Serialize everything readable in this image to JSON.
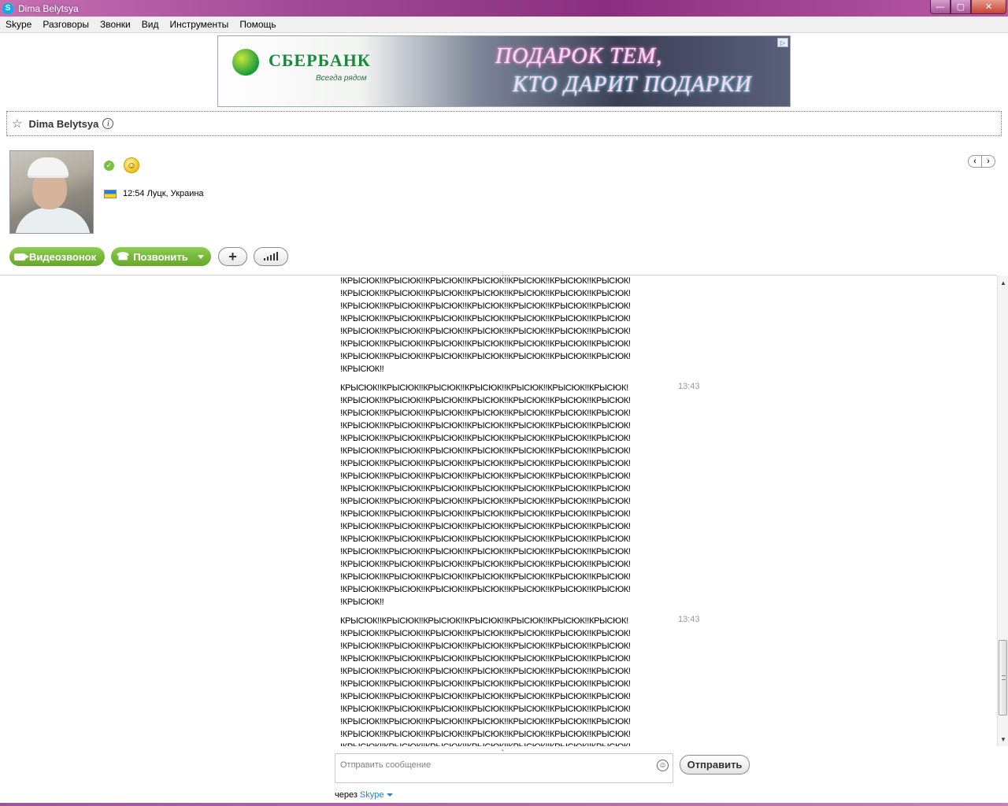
{
  "window": {
    "title": "Dima Belytsya",
    "app_icon": "skype-icon",
    "buttons": [
      "minimize-icon",
      "maximize-icon",
      "close-icon"
    ]
  },
  "menu": [
    "Skype",
    "Разговоры",
    "Звонки",
    "Вид",
    "Инструменты",
    "Помощь"
  ],
  "ad": {
    "brand": "СБЕРБАНК",
    "slogan": "Всегда рядом",
    "promo_line1": "ПОДАРОК ТЕМ,",
    "promo_line2": "КТО ДАРИТ ПОДАРКИ",
    "adchoices": "▷"
  },
  "contact": {
    "name": "Dima Belytsya",
    "star_icon": "☆",
    "info_icon": "i",
    "status_mark": "✓",
    "mood_emoticon": "☺",
    "local_time_location": "12:54 Луцк, Украина"
  },
  "nav": {
    "prev": "‹",
    "next": "›"
  },
  "actions": {
    "video_call": "Видеозвонок",
    "call": "Позвонить",
    "add": "+",
    "call_quality": "signal-bars-icon"
  },
  "chat": {
    "divider_handle": "...",
    "messages": [
      {
        "time": "",
        "lines": [
          "!КРЫСЮК!!КРЫСЮК!!КРЫСЮК!!КРЫСЮК!!КРЫСЮК!!КРЫСЮК!!КРЫСЮК!",
          "!КРЫСЮК!!КРЫСЮК!!КРЫСЮК!!КРЫСЮК!!КРЫСЮК!!КРЫСЮК!!КРЫСЮК!",
          "!КРЫСЮК!!КРЫСЮК!!КРЫСЮК!!КРЫСЮК!!КРЫСЮК!!КРЫСЮК!!КРЫСЮК!",
          "!КРЫСЮК!!КРЫСЮК!!КРЫСЮК!!КРЫСЮК!!КРЫСЮК!!КРЫСЮК!!КРЫСЮК!",
          "!КРЫСЮК!!КРЫСЮК!!КРЫСЮК!!КРЫСЮК!!КРЫСЮК!!КРЫСЮК!!КРЫСЮК!",
          "!КРЫСЮК!!КРЫСЮК!!КРЫСЮК!!КРЫСЮК!!КРЫСЮК!!КРЫСЮК!!КРЫСЮК!",
          "!КРЫСЮК!!КРЫСЮК!!КРЫСЮК!!КРЫСЮК!!КРЫСЮК!!КРЫСЮК!!КРЫСЮК!",
          "!КРЫСЮК!!"
        ]
      },
      {
        "time": "13:43",
        "lines": [
          "КРЫСЮК!!КРЫСЮК!!КРЫСЮК!!КРЫСЮК!!КРЫСЮК!!КРЫСЮК!!КРЫСЮК!",
          "!КРЫСЮК!!КРЫСЮК!!КРЫСЮК!!КРЫСЮК!!КРЫСЮК!!КРЫСЮК!!КРЫСЮК!",
          "!КРЫСЮК!!КРЫСЮК!!КРЫСЮК!!КРЫСЮК!!КРЫСЮК!!КРЫСЮК!!КРЫСЮК!",
          "!КРЫСЮК!!КРЫСЮК!!КРЫСЮК!!КРЫСЮК!!КРЫСЮК!!КРЫСЮК!!КРЫСЮК!",
          "!КРЫСЮК!!КРЫСЮК!!КРЫСЮК!!КРЫСЮК!!КРЫСЮК!!КРЫСЮК!!КРЫСЮК!",
          "!КРЫСЮК!!КРЫСЮК!!КРЫСЮК!!КРЫСЮК!!КРЫСЮК!!КРЫСЮК!!КРЫСЮК!",
          "!КРЫСЮК!!КРЫСЮК!!КРЫСЮК!!КРЫСЮК!!КРЫСЮК!!КРЫСЮК!!КРЫСЮК!",
          "!КРЫСЮК!!КРЫСЮК!!КРЫСЮК!!КРЫСЮК!!КРЫСЮК!!КРЫСЮК!!КРЫСЮК!",
          "!КРЫСЮК!!КРЫСЮК!!КРЫСЮК!!КРЫСЮК!!КРЫСЮК!!КРЫСЮК!!КРЫСЮК!",
          "!КРЫСЮК!!КРЫСЮК!!КРЫСЮК!!КРЫСЮК!!КРЫСЮК!!КРЫСЮК!!КРЫСЮК!",
          "!КРЫСЮК!!КРЫСЮК!!КРЫСЮК!!КРЫСЮК!!КРЫСЮК!!КРЫСЮК!!КРЫСЮК!",
          "!КРЫСЮК!!КРЫСЮК!!КРЫСЮК!!КРЫСЮК!!КРЫСЮК!!КРЫСЮК!!КРЫСЮК!",
          "!КРЫСЮК!!КРЫСЮК!!КРЫСЮК!!КРЫСЮК!!КРЫСЮК!!КРЫСЮК!!КРЫСЮК!",
          "!КРЫСЮК!!КРЫСЮК!!КРЫСЮК!!КРЫСЮК!!КРЫСЮК!!КРЫСЮК!!КРЫСЮК!",
          "!КРЫСЮК!!КРЫСЮК!!КРЫСЮК!!КРЫСЮК!!КРЫСЮК!!КРЫСЮК!!КРЫСЮК!",
          "!КРЫСЮК!!КРЫСЮК!!КРЫСЮК!!КРЫСЮК!!КРЫСЮК!!КРЫСЮК!!КРЫСЮК!",
          "!КРЫСЮК!!КРЫСЮК!!КРЫСЮК!!КРЫСЮК!!КРЫСЮК!!КРЫСЮК!!КРЫСЮК!",
          "!КРЫСЮК!!"
        ]
      },
      {
        "time": "13:43",
        "lines": [
          "КРЫСЮК!!КРЫСЮК!!КРЫСЮК!!КРЫСЮК!!КРЫСЮК!!КРЫСЮК!!КРЫСЮК!",
          "!КРЫСЮК!!КРЫСЮК!!КРЫСЮК!!КРЫСЮК!!КРЫСЮК!!КРЫСЮК!!КРЫСЮК!",
          "!КРЫСЮК!!КРЫСЮК!!КРЫСЮК!!КРЫСЮК!!КРЫСЮК!!КРЫСЮК!!КРЫСЮК!",
          "!КРЫСЮК!!КРЫСЮК!!КРЫСЮК!!КРЫСЮК!!КРЫСЮК!!КРЫСЮК!!КРЫСЮК!",
          "!КРЫСЮК!!КРЫСЮК!!КРЫСЮК!!КРЫСЮК!!КРЫСЮК!!КРЫСЮК!!КРЫСЮК!",
          "!КРЫСЮК!!КРЫСЮК!!КРЫСЮК!!КРЫСЮК!!КРЫСЮК!!КРЫСЮК!!КРЫСЮК!",
          "!КРЫСЮК!!КРЫСЮК!!КРЫСЮК!!КРЫСЮК!!КРЫСЮК!!КРЫСЮК!!КРЫСЮК!",
          "!КРЫСЮК!!КРЫСЮК!!КРЫСЮК!!КРЫСЮК!!КРЫСЮК!!КРЫСЮК!!КРЫСЮК!",
          "!КРЫСЮК!!КРЫСЮК!!КРЫСЮК!!КРЫСЮК!!КРЫСЮК!!КРЫСЮК!!КРЫСЮК!",
          "!КРЫСЮК!!КРЫСЮК!!КРЫСЮК!!КРЫСЮК!!КРЫСЮК!!КРЫСЮК!!КРЫСЮК!",
          "!КРЫСЮК!!КРЫСЮК!!КРЫСЮК!!КРЫСЮК!!КРЫСЮК!!КРЫСЮК!!КРЫСЮК!"
        ]
      }
    ]
  },
  "compose": {
    "placeholder": "Отправить сообщение",
    "value": "",
    "emoticon_icon": "☺",
    "send_label": "Отправить",
    "via_prefix": "через",
    "via_service": "Skype"
  },
  "scroll": {
    "position": 0.85
  },
  "colors": {
    "titlebar": "#a04a96",
    "skype_green": "#7ac143",
    "link_blue": "#2a7fc8",
    "timestamp": "#9a9a9a"
  }
}
